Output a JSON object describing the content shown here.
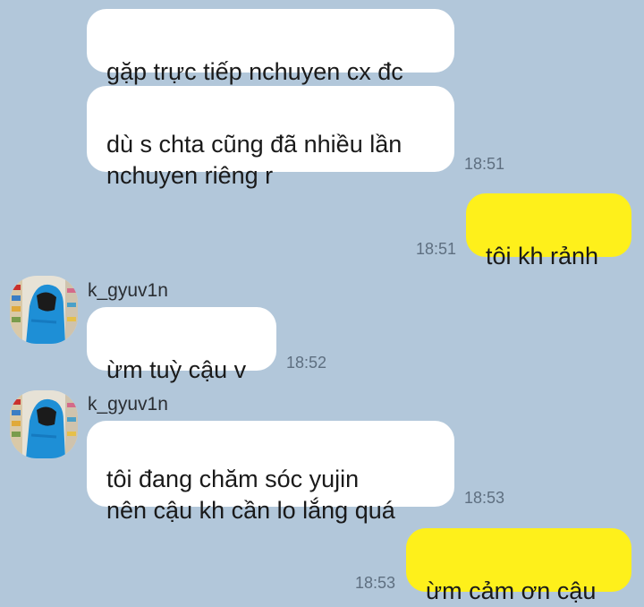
{
  "colors": {
    "background": "#b2c7da",
    "incoming_bubble": "#ffffff",
    "outgoing_bubble": "#fef01b",
    "timestamp": "#5e6f80"
  },
  "messages": [
    {
      "direction": "incoming",
      "text": "gặp trực tiếp nchuyen cx đc",
      "time": ""
    },
    {
      "direction": "incoming",
      "text": "dù s chta cũng đã nhiều lần\nnchuyen riêng r",
      "time": "18:51"
    },
    {
      "direction": "outgoing",
      "text": "tôi kh rảnh",
      "time": "18:51"
    },
    {
      "direction": "incoming",
      "sender": "k_gyuv1n",
      "avatar": "avatar-photo",
      "text": "ừm tuỳ cậu v",
      "time": "18:52"
    },
    {
      "direction": "incoming",
      "sender": "k_gyuv1n",
      "avatar": "avatar-photo",
      "text": "tôi đang chăm sóc yujin\nnên cậu kh cần lo lắng quá",
      "time": "18:53"
    },
    {
      "direction": "outgoing",
      "text": "ừm cảm ơn cậu",
      "time": "18:53"
    }
  ]
}
